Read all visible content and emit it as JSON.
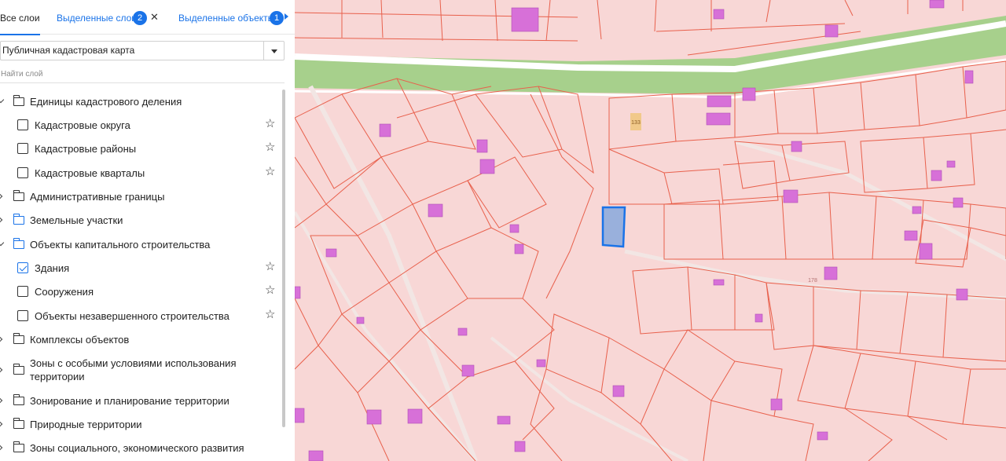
{
  "tabs": {
    "all_layers": "Все слои",
    "selected_layers": "Выделенные слои",
    "selected_layers_count": "2",
    "selected_objects": "Выделенные объекты",
    "selected_objects_count": "1"
  },
  "basemap_select": {
    "value": "Публичная кадастровая карта"
  },
  "layer_search": {
    "placeholder": "Найти слой"
  },
  "layers": [
    {
      "label": "Единицы кадастрового деления"
    },
    {
      "label": "Кадастровые округа"
    },
    {
      "label": "Кадастровые районы"
    },
    {
      "label": "Кадастровые кварталы"
    },
    {
      "label": "Административные границы"
    },
    {
      "label": "Земельные участки"
    },
    {
      "label": "Объекты капитального строительства"
    },
    {
      "label": "Здания"
    },
    {
      "label": "Сооружения"
    },
    {
      "label": "Объекты незавершенного строительства"
    },
    {
      "label": "Комплексы объектов"
    },
    {
      "label": "Зоны с особыми условиями использования территории"
    },
    {
      "label": "Зонирование и планирование территории"
    },
    {
      "label": "Природные территории"
    },
    {
      "label": "Зоны социального, экономического развития"
    }
  ],
  "map": {
    "labels": {
      "plot_133": "133",
      "plot_178": "178"
    },
    "colors": {
      "parcel_fill": "#f8d7d6",
      "parcel_line": "#e8604c",
      "building": "#d770d8",
      "greenbelt": "#a7d08c",
      "road": "#ffffff",
      "selected": "#4a90e2",
      "plot_highlight": "#f1c98a"
    }
  }
}
